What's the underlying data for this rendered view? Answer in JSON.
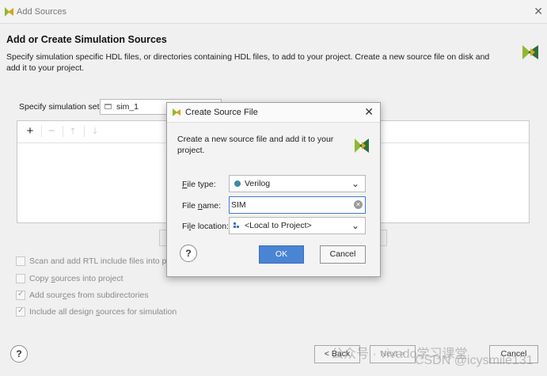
{
  "window": {
    "title": "Add Sources"
  },
  "header": {
    "heading": "Add or Create Simulation Sources",
    "description": "Specify simulation specific HDL files, or directories containing HDL files, to add to your project. Create a new source file on disk and add it to your project."
  },
  "simulation_set": {
    "label": "Specify simulation set:",
    "value": "sim_1"
  },
  "toolbar": {
    "add": "+",
    "remove": "−",
    "up": "🡑",
    "down": "🡓"
  },
  "checkboxes": [
    {
      "label": "Scan and add RTL include files into proje",
      "checked": false
    },
    {
      "label_pre": "Copy ",
      "label_u": "s",
      "label_post": "ources into project",
      "checked": false
    },
    {
      "label_pre": "Add sour",
      "label_u": "c",
      "label_post": "es from subdirectories",
      "checked": true
    },
    {
      "label_pre": "Include all design ",
      "label_u": "s",
      "label_post": "ources for simulation",
      "checked": true
    }
  ],
  "footer": {
    "help": "?",
    "back": "< Back",
    "next": "Next >",
    "cancel": "Cancel"
  },
  "watermark": {
    "text1": "公众号 · vivado学习课堂",
    "text2": "CSDN @icysmile131"
  },
  "dialog": {
    "title": "Create Source File",
    "description": "Create a new source file and add it to your project.",
    "file_type": {
      "label_u": "F",
      "label_rest": "ile type:",
      "value": "Verilog"
    },
    "file_name": {
      "label_pre": "File ",
      "label_u": "n",
      "label_post": "ame:",
      "value": "SIM"
    },
    "file_location": {
      "label_pre": "Fi",
      "label_u": "l",
      "label_post": "e location:",
      "value": "<Local to Project>"
    },
    "help": "?",
    "ok": "OK",
    "cancel": "Cancel"
  },
  "colors": {
    "accent": "#4a84d4",
    "logo_green": "#8fb92e",
    "logo_dark": "#2d6f3a"
  }
}
